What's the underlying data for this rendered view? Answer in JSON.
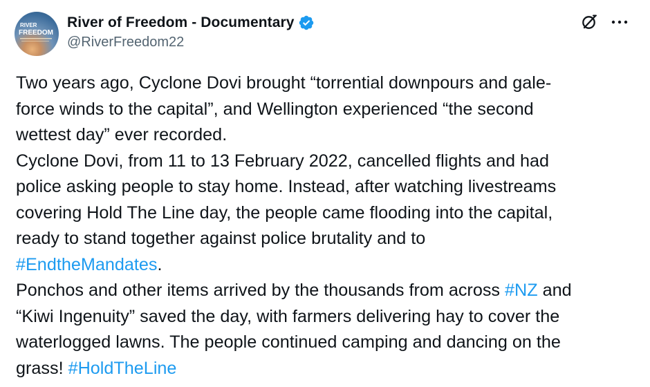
{
  "author": {
    "display_name": "River of Freedom - Documentary",
    "handle": "@RiverFreedom22",
    "verified_color": "#1d9bf0",
    "avatar_text_line1": "RIVER",
    "avatar_text_line2": "FREEDOM"
  },
  "icons": {
    "grok": "grok-icon",
    "more": "more-icon",
    "verified": "verified-badge-icon"
  },
  "tweet": {
    "line1_a": "Two years ago, Cyclone Dovi brought “torrential downpours and gale-",
    "line1_b": "force winds to the capital”, and Wellington experienced “the second",
    "line1_c": "wettest day” ever recorded.",
    "line2_a": "Cyclone Dovi, from 11 to 13 February 2022, cancelled flights and had",
    "line2_b": "police asking people to stay home. Instead, after watching livestreams",
    "line2_c": "covering Hold The Line day, the people came flooding into the capital,",
    "line2_d": "ready to stand together against police brutality and to",
    "hashtag_endthemandates": "#EndtheMandates",
    "line2_end": ".",
    "line3_a": "Ponchos and other items arrived by the thousands from across ",
    "hashtag_nz": "#NZ",
    "line3_a_end": " and",
    "line3_b": "“Kiwi Ingenuity” saved the day, with farmers delivering hay to cover the",
    "line3_c": "waterlogged lawns. The people continued camping and dancing on the",
    "line3_d": "grass! ",
    "hashtag_holdtheline": "#HoldTheLine"
  },
  "colors": {
    "link": "#1d9bf0",
    "text": "#0f1419",
    "secondary": "#536471"
  }
}
